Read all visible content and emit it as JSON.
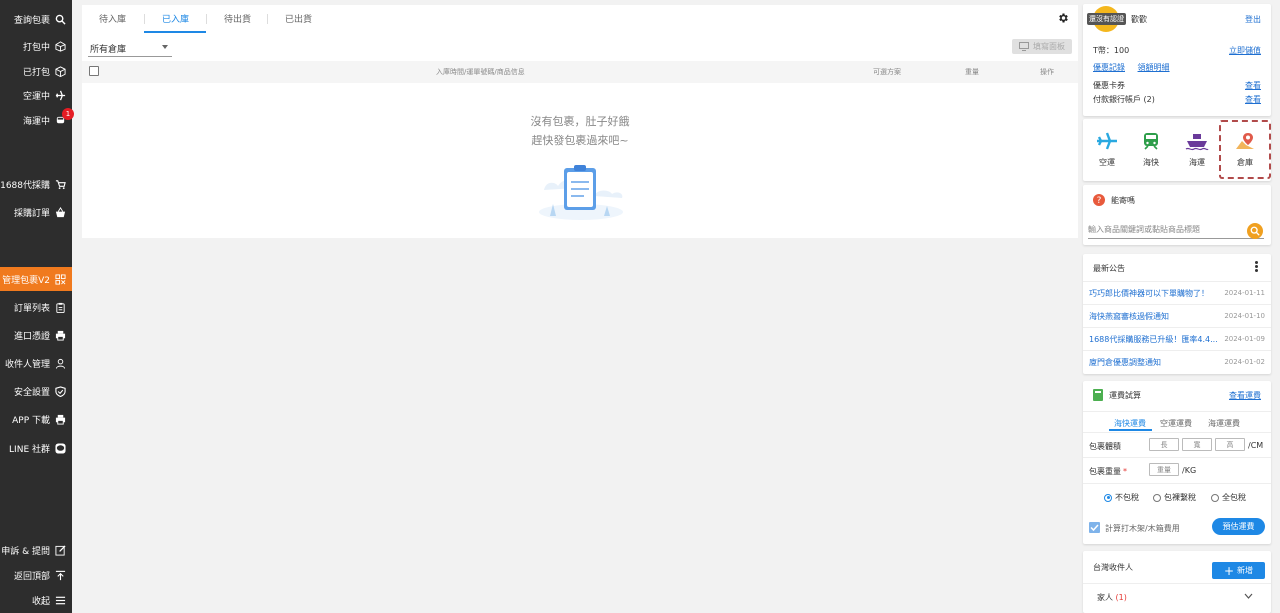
{
  "sidebar": {
    "items": [
      {
        "label": "查詢包裹",
        "icon": "search-icon"
      },
      {
        "label": "打包中",
        "icon": "box-icon"
      },
      {
        "label": "已打包",
        "icon": "package-icon"
      },
      {
        "label": "空運中",
        "icon": "plane-icon"
      },
      {
        "label": "海運中",
        "icon": "train-icon",
        "badge": "1"
      },
      {
        "label": "1688代採購",
        "icon": "cart-icon"
      },
      {
        "label": "採購訂單",
        "icon": "basket-icon"
      },
      {
        "label": "管理包裹V2",
        "icon": "grid-icon"
      },
      {
        "label": "訂單列表",
        "icon": "clipboard-icon"
      },
      {
        "label": "進口憑證",
        "icon": "printer-icon"
      },
      {
        "label": "收件人管理",
        "icon": "user-icon"
      },
      {
        "label": "安全設置",
        "icon": "shield-icon"
      },
      {
        "label": "APP 下載",
        "icon": "download-icon"
      },
      {
        "label": "LINE 社群",
        "icon": "line-icon"
      },
      {
        "label": "申訴 & 提問",
        "icon": "edit-icon"
      },
      {
        "label": "返回頂部",
        "icon": "arrow-up-icon"
      },
      {
        "label": "收起",
        "icon": "menu-icon"
      }
    ]
  },
  "main": {
    "tabs": [
      "待入庫",
      "已入庫",
      "待出貨",
      "已出貨"
    ],
    "active_tab": "已入庫",
    "warehouse_select": "所有倉庫",
    "apply_button": "填寫面板",
    "table_headers": {
      "info": "入庫時間/運單號碼/商品信息",
      "shipping": "可選方案",
      "weight": "重量",
      "action": "操作"
    },
    "empty_line1": "沒有包裹，肚子好餓",
    "empty_line2": "趕快發包裹過來吧~"
  },
  "user": {
    "avatar_badge": "還沒有認證",
    "greeting": "歡歡",
    "logout": "登出",
    "t_coin_label": "T幣：100",
    "recharge": "立即儲值",
    "coupon_record": "優惠記錄",
    "quota_detail": "領額明細",
    "voucher_label": "優惠卡券",
    "voucher_link": "查看",
    "bank_label": "付款銀行帳戶 (2)",
    "bank_link": "查看"
  },
  "shipping_options": [
    {
      "label": "空運",
      "icon": "plane-icon",
      "color": "#29a8e0"
    },
    {
      "label": "海快",
      "icon": "train-icon",
      "color": "#2e9e4a"
    },
    {
      "label": "海運",
      "icon": "ship-icon",
      "color": "#6a3a9a"
    },
    {
      "label": "倉庫",
      "icon": "map-pin-icon",
      "color": "#e05a4a"
    }
  ],
  "help": {
    "title": "能寄嗎",
    "placeholder": "輸入商品關鍵詞或黏貼商品標題"
  },
  "announcements": {
    "title": "最新公告",
    "items": [
      {
        "title": "巧巧郎比價神器可以下單購物了！",
        "date": "2024-01-11"
      },
      {
        "title": "海快燕窩審核過假通知",
        "date": "2024-01-10"
      },
      {
        "title": "1688代採購服務已升級！匯率4.4...",
        "date": "2024-01-09"
      },
      {
        "title": "廈門倉優惠調整通知",
        "date": "2024-01-02"
      }
    ]
  },
  "fee_calc": {
    "title": "運費試算",
    "view_link": "查看運費",
    "tabs": [
      "海快運費",
      "空運運費",
      "海運運費"
    ],
    "size_label": "包裹體積",
    "length": "長",
    "width": "寬",
    "height": "高",
    "size_unit": "/CM",
    "weight_label": "包裹重量",
    "required_mark": "*",
    "weight_placeholder": "重量",
    "weight_unit": "/KG",
    "tax_options": [
      "不包稅",
      "包裸繫稅",
      "全包稅"
    ],
    "checkbox_label": "計算打木架/木箱費用",
    "estimate_button": "預估運費"
  },
  "recipient": {
    "title": "台灣收件人",
    "add_button": "新增",
    "family_label": "家人",
    "family_count": "(1)"
  }
}
